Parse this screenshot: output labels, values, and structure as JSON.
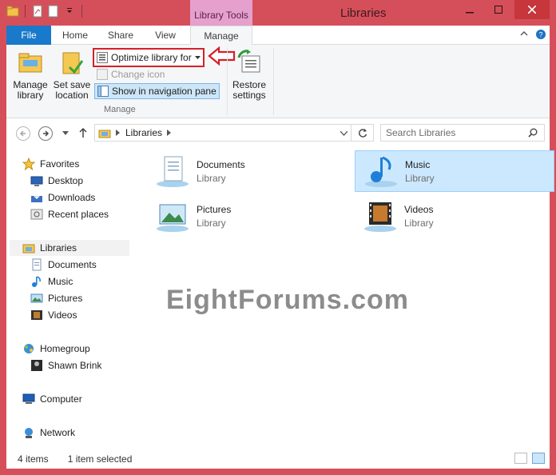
{
  "window": {
    "title": "Libraries",
    "context_tab": "Library Tools",
    "accent": "#d54f5a"
  },
  "tabs": [
    {
      "label": "File"
    },
    {
      "label": "Home"
    },
    {
      "label": "Share"
    },
    {
      "label": "View"
    },
    {
      "label": "Manage"
    }
  ],
  "ribbon": {
    "manage_library": "Manage library",
    "set_save_location": "Set save location",
    "optimize_library_for": "Optimize library for",
    "change_icon": "Change icon",
    "show_in_nav_pane": "Show in navigation pane",
    "group_label": "Manage",
    "restore_settings": "Restore settings"
  },
  "address": {
    "path": "Libraries",
    "search_placeholder": "Search Libraries"
  },
  "nav": {
    "favorites": "Favorites",
    "desktop": "Desktop",
    "downloads": "Downloads",
    "recent_places": "Recent places",
    "libraries": "Libraries",
    "documents": "Documents",
    "music": "Music",
    "pictures": "Pictures",
    "videos": "Videos",
    "homegroup": "Homegroup",
    "shawn_brink": "Shawn Brink",
    "computer": "Computer",
    "network": "Network"
  },
  "content": {
    "items": [
      {
        "name": "Documents",
        "type": "Library"
      },
      {
        "name": "Music",
        "type": "Library"
      },
      {
        "name": "Pictures",
        "type": "Library"
      },
      {
        "name": "Videos",
        "type": "Library"
      }
    ],
    "watermark": "EightForums.com"
  },
  "status": {
    "count": "4 items",
    "selection": "1 item selected"
  }
}
